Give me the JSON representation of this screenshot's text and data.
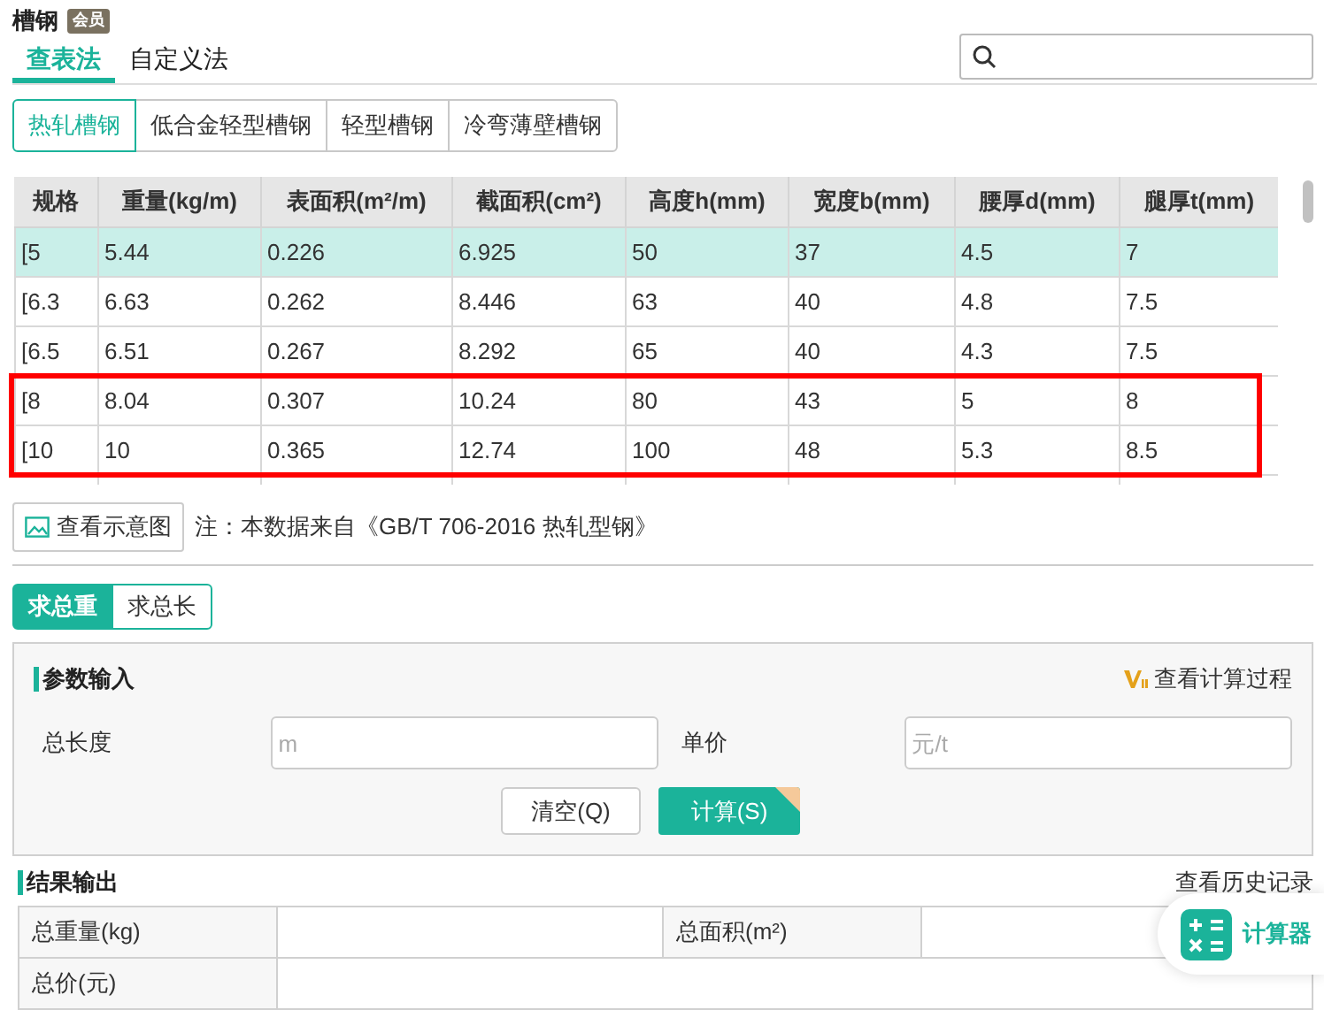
{
  "title": "槽钢",
  "badge": "会员",
  "method_tabs": [
    {
      "label": "查表法",
      "selected": true
    },
    {
      "label": "自定义法",
      "selected": false
    }
  ],
  "type_tabs": [
    {
      "label": "热轧槽钢",
      "selected": true
    },
    {
      "label": "低合金轻型槽钢",
      "selected": false
    },
    {
      "label": "轻型槽钢",
      "selected": false
    },
    {
      "label": "冷弯薄壁槽钢",
      "selected": false
    }
  ],
  "table": {
    "columns": [
      "规格",
      "重量(kg/m)",
      "表面积(m²/m)",
      "截面积(cm²)",
      "高度h(mm)",
      "宽度b(mm)",
      "腰厚d(mm)",
      "腿厚t(mm)"
    ],
    "rows": [
      {
        "cells": [
          "[5",
          "5.44",
          "0.226",
          "6.925",
          "50",
          "37",
          "4.5",
          "7"
        ],
        "selected": true,
        "highlighted": false
      },
      {
        "cells": [
          "[6.3",
          "6.63",
          "0.262",
          "8.446",
          "63",
          "40",
          "4.8",
          "7.5"
        ],
        "selected": false,
        "highlighted": false
      },
      {
        "cells": [
          "[6.5",
          "6.51",
          "0.267",
          "8.292",
          "65",
          "40",
          "4.3",
          "7.5"
        ],
        "selected": false,
        "highlighted": false
      },
      {
        "cells": [
          "[8",
          "8.04",
          "0.307",
          "10.24",
          "80",
          "43",
          "5",
          "8"
        ],
        "selected": false,
        "highlighted": true
      },
      {
        "cells": [
          "[10",
          "10",
          "0.365",
          "12.74",
          "100",
          "48",
          "5.3",
          "8.5"
        ],
        "selected": false,
        "highlighted": true
      }
    ]
  },
  "diagram_button": "查看示意图",
  "note": "注：本数据来自《GB/T 706-2016 热轧型钢》",
  "calc_tabs": [
    {
      "label": "求总重",
      "selected": true
    },
    {
      "label": "求总长",
      "selected": false
    }
  ],
  "input_section": {
    "title": "参数输入",
    "process_link": "查看计算过程",
    "fields": [
      {
        "label": "总长度",
        "placeholder": "m"
      },
      {
        "label": "单价",
        "placeholder": "元/t"
      }
    ],
    "clear_button": "清空(Q)",
    "calc_button": "计算(S)"
  },
  "output_section": {
    "title": "结果输出",
    "history_link": "查看历史记录",
    "results": [
      {
        "label": "总重量(kg)"
      },
      {
        "label": "总面积(m²)"
      },
      {
        "label": "总价(元)"
      }
    ]
  },
  "calculator_button": "计算器"
}
